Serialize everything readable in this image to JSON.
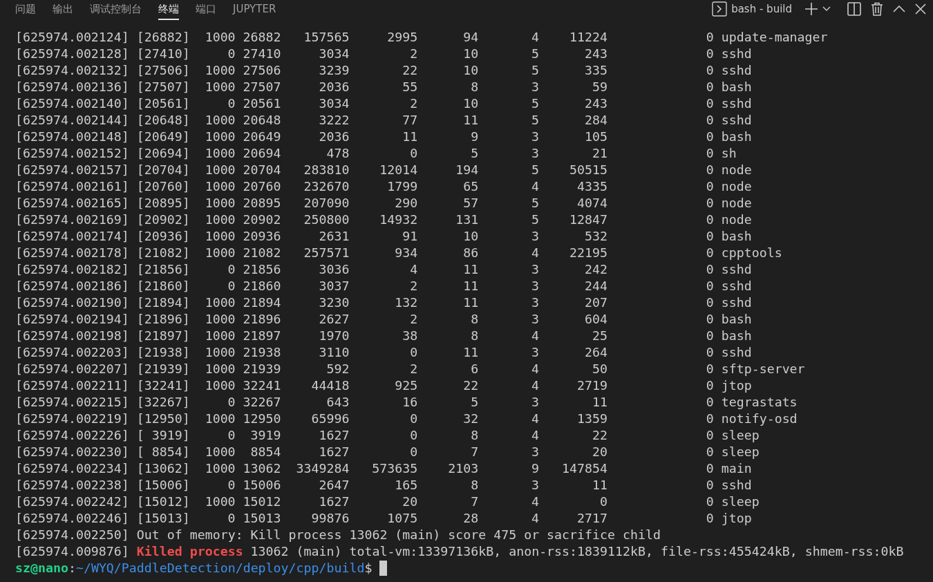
{
  "panel": {
    "tabs": [
      {
        "label": "问题",
        "selected": false
      },
      {
        "label": "输出",
        "selected": false
      },
      {
        "label": "调试控制台",
        "selected": false
      },
      {
        "label": "终端",
        "selected": true
      },
      {
        "label": "端口",
        "selected": false
      },
      {
        "label": "JUPYTER",
        "selected": false
      }
    ],
    "terminal_selector": "bash - build"
  },
  "terminal": {
    "rows": [
      [
        "[625974.002124]",
        "[26882]",
        "1000",
        "26882",
        "157565",
        "2995",
        "94",
        "4",
        "11224",
        "0",
        "update-manager"
      ],
      [
        "[625974.002128]",
        "[27410]",
        "0",
        "27410",
        "3034",
        "2",
        "10",
        "5",
        "243",
        "0",
        "sshd"
      ],
      [
        "[625974.002132]",
        "[27506]",
        "1000",
        "27506",
        "3239",
        "22",
        "10",
        "5",
        "335",
        "0",
        "sshd"
      ],
      [
        "[625974.002136]",
        "[27507]",
        "1000",
        "27507",
        "2036",
        "55",
        "8",
        "3",
        "59",
        "0",
        "bash"
      ],
      [
        "[625974.002140]",
        "[20561]",
        "0",
        "20561",
        "3034",
        "2",
        "10",
        "5",
        "243",
        "0",
        "sshd"
      ],
      [
        "[625974.002144]",
        "[20648]",
        "1000",
        "20648",
        "3222",
        "77",
        "11",
        "5",
        "284",
        "0",
        "sshd"
      ],
      [
        "[625974.002148]",
        "[20649]",
        "1000",
        "20649",
        "2036",
        "11",
        "9",
        "3",
        "105",
        "0",
        "bash"
      ],
      [
        "[625974.002152]",
        "[20694]",
        "1000",
        "20694",
        "478",
        "0",
        "5",
        "3",
        "21",
        "0",
        "sh"
      ],
      [
        "[625974.002157]",
        "[20704]",
        "1000",
        "20704",
        "283810",
        "12014",
        "194",
        "5",
        "50515",
        "0",
        "node"
      ],
      [
        "[625974.002161]",
        "[20760]",
        "1000",
        "20760",
        "232670",
        "1799",
        "65",
        "4",
        "4335",
        "0",
        "node"
      ],
      [
        "[625974.002165]",
        "[20895]",
        "1000",
        "20895",
        "207090",
        "290",
        "57",
        "5",
        "4074",
        "0",
        "node"
      ],
      [
        "[625974.002169]",
        "[20902]",
        "1000",
        "20902",
        "250800",
        "14932",
        "131",
        "5",
        "12847",
        "0",
        "node"
      ],
      [
        "[625974.002174]",
        "[20936]",
        "1000",
        "20936",
        "2631",
        "91",
        "10",
        "3",
        "532",
        "0",
        "bash"
      ],
      [
        "[625974.002178]",
        "[21082]",
        "1000",
        "21082",
        "257571",
        "934",
        "86",
        "4",
        "22195",
        "0",
        "cpptools"
      ],
      [
        "[625974.002182]",
        "[21856]",
        "0",
        "21856",
        "3036",
        "4",
        "11",
        "3",
        "242",
        "0",
        "sshd"
      ],
      [
        "[625974.002186]",
        "[21860]",
        "0",
        "21860",
        "3037",
        "2",
        "11",
        "3",
        "244",
        "0",
        "sshd"
      ],
      [
        "[625974.002190]",
        "[21894]",
        "1000",
        "21894",
        "3230",
        "132",
        "11",
        "3",
        "207",
        "0",
        "sshd"
      ],
      [
        "[625974.002194]",
        "[21896]",
        "1000",
        "21896",
        "2627",
        "2",
        "8",
        "3",
        "604",
        "0",
        "bash"
      ],
      [
        "[625974.002198]",
        "[21897]",
        "1000",
        "21897",
        "1970",
        "38",
        "8",
        "4",
        "25",
        "0",
        "bash"
      ],
      [
        "[625974.002203]",
        "[21938]",
        "1000",
        "21938",
        "3110",
        "0",
        "11",
        "3",
        "264",
        "0",
        "sshd"
      ],
      [
        "[625974.002207]",
        "[21939]",
        "1000",
        "21939",
        "592",
        "2",
        "6",
        "4",
        "50",
        "0",
        "sftp-server"
      ],
      [
        "[625974.002211]",
        "[32241]",
        "1000",
        "32241",
        "44418",
        "925",
        "22",
        "4",
        "2719",
        "0",
        "jtop"
      ],
      [
        "[625974.002215]",
        "[32267]",
        "0",
        "32267",
        "643",
        "16",
        "5",
        "3",
        "11",
        "0",
        "tegrastats"
      ],
      [
        "[625974.002219]",
        "[12950]",
        "1000",
        "12950",
        "65996",
        "0",
        "32",
        "4",
        "1359",
        "0",
        "notify-osd"
      ],
      [
        "[625974.002226]",
        "[ 3919]",
        "0",
        "3919",
        "1627",
        "0",
        "8",
        "4",
        "22",
        "0",
        "sleep"
      ],
      [
        "[625974.002230]",
        "[ 8854]",
        "1000",
        "8854",
        "1627",
        "0",
        "7",
        "3",
        "20",
        "0",
        "sleep"
      ],
      [
        "[625974.002234]",
        "[13062]",
        "1000",
        "13062",
        "3349284",
        "573635",
        "2103",
        "9",
        "147854",
        "0",
        "main"
      ],
      [
        "[625974.002238]",
        "[15006]",
        "0",
        "15006",
        "2647",
        "165",
        "8",
        "3",
        "11",
        "0",
        "sshd"
      ],
      [
        "[625974.002242]",
        "[15012]",
        "1000",
        "15012",
        "1627",
        "20",
        "7",
        "4",
        "0",
        "0",
        "sleep"
      ],
      [
        "[625974.002246]",
        "[15013]",
        "0",
        "15013",
        "99876",
        "1075",
        "28",
        "4",
        "2717",
        "0",
        "jtop"
      ]
    ],
    "messages": [
      {
        "kind": "info",
        "time": "[625974.002250]",
        "text": "Out of memory: Kill process 13062 (main) score 475 or sacrifice child"
      },
      {
        "kind": "alert",
        "time": "[625974.009876]",
        "alert": "Killed process",
        "text": "13062 (main) total-vm:13397136kB, anon-rss:1839112kB, file-rss:455424kB, shmem-rss:0kB"
      }
    ],
    "prompt": {
      "user": "sz@nano",
      "separator": ":",
      "path": "~/WYQ/PaddleDetection/deploy/cpp/build",
      "symbol": "$"
    }
  }
}
